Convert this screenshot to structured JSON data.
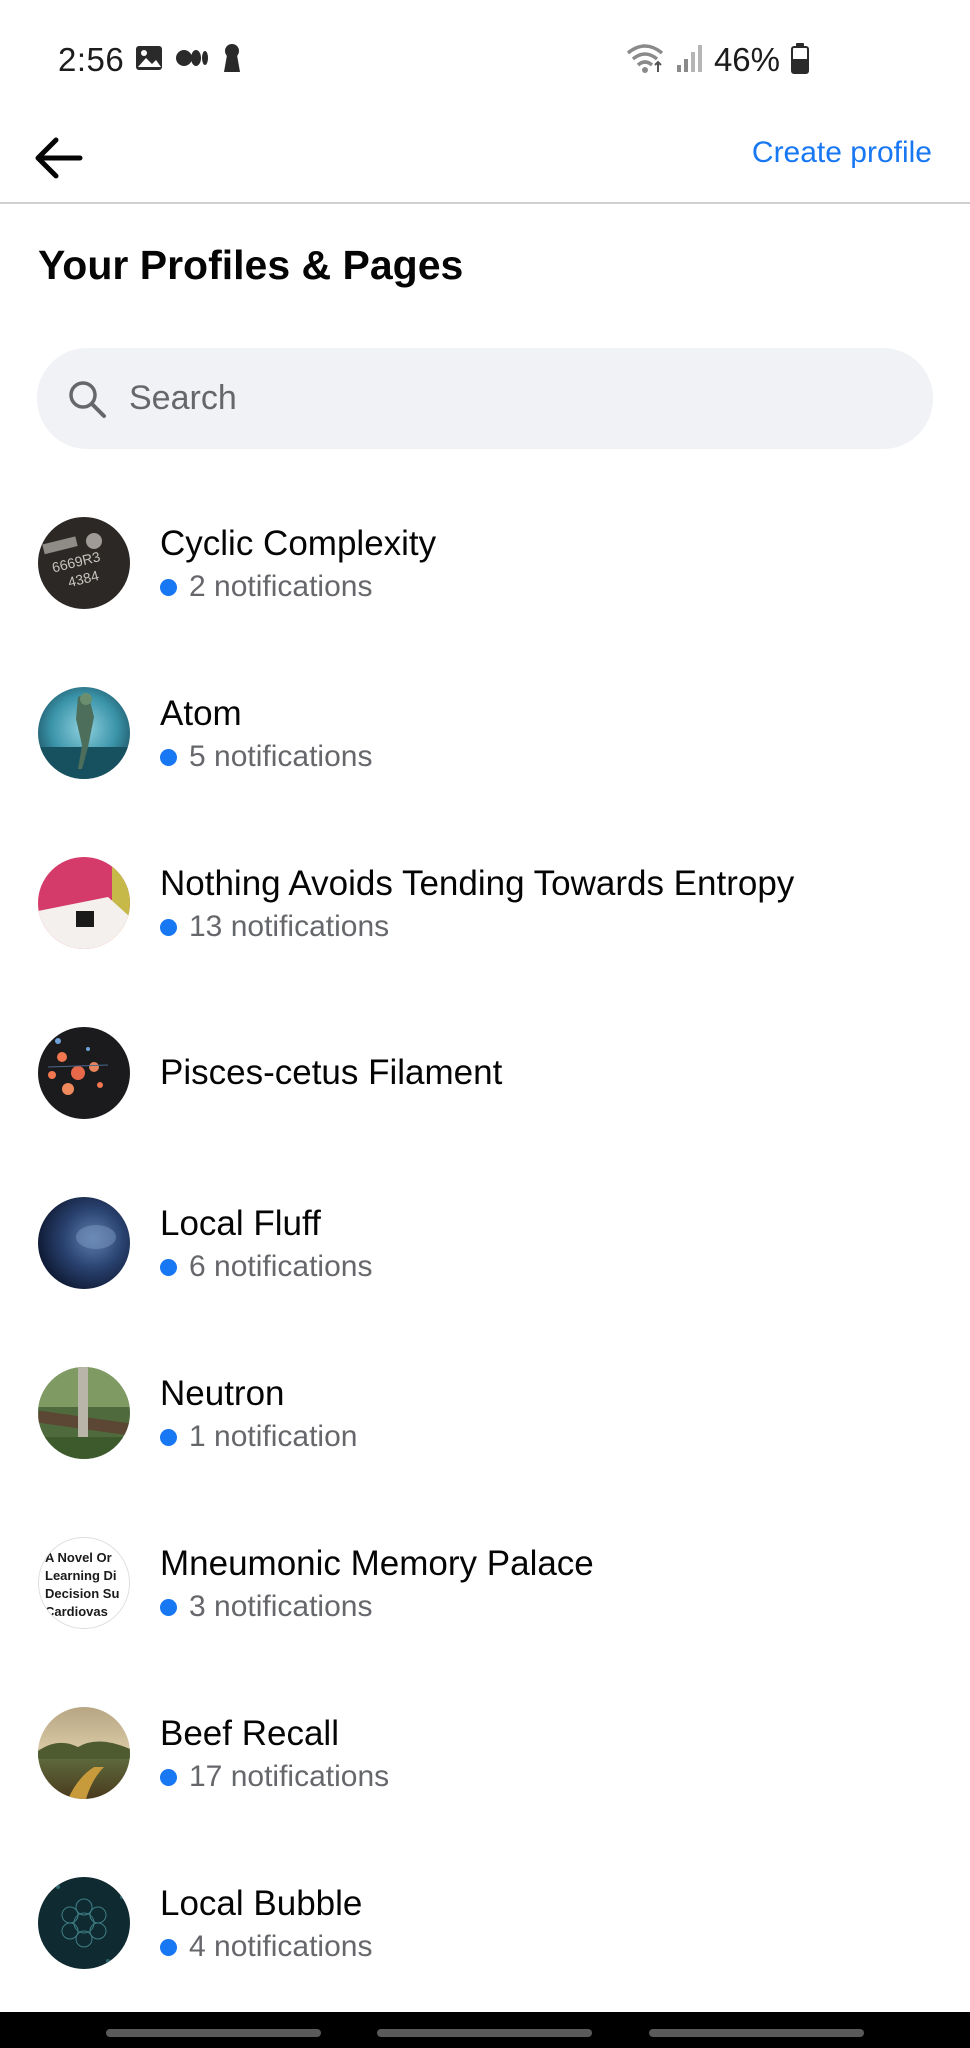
{
  "status_bar": {
    "time": "2:56",
    "battery": "46%"
  },
  "header": {
    "create_label": "Create profile"
  },
  "page": {
    "title": "Your Profiles & Pages"
  },
  "search": {
    "placeholder": "Search"
  },
  "profiles": [
    {
      "name": "Cyclic Complexity",
      "notifications": "2 notifications",
      "avatar_text": [
        "6669R3",
        "4384"
      ]
    },
    {
      "name": "Atom",
      "notifications": "5 notifications"
    },
    {
      "name": "Nothing Avoids Tending Towards Entropy",
      "notifications": "13 notifications"
    },
    {
      "name": "Pisces-cetus Filament",
      "notifications": ""
    },
    {
      "name": "Local Fluff",
      "notifications": "6 notifications"
    },
    {
      "name": "Neutron",
      "notifications": "1 notification"
    },
    {
      "name": "Mneumonic Memory Palace",
      "notifications": "3 notifications",
      "avatar_text": [
        "A Novel Or",
        "Learning Di",
        "Decision Su",
        "Cardiovas"
      ]
    },
    {
      "name": "Beef Recall",
      "notifications": "17 notifications"
    },
    {
      "name": "Local Bubble",
      "notifications": "4 notifications"
    }
  ],
  "colors": {
    "accent": "#1877f2",
    "notif_dot": "#1877f2",
    "search_bg": "#f0f2f5"
  }
}
